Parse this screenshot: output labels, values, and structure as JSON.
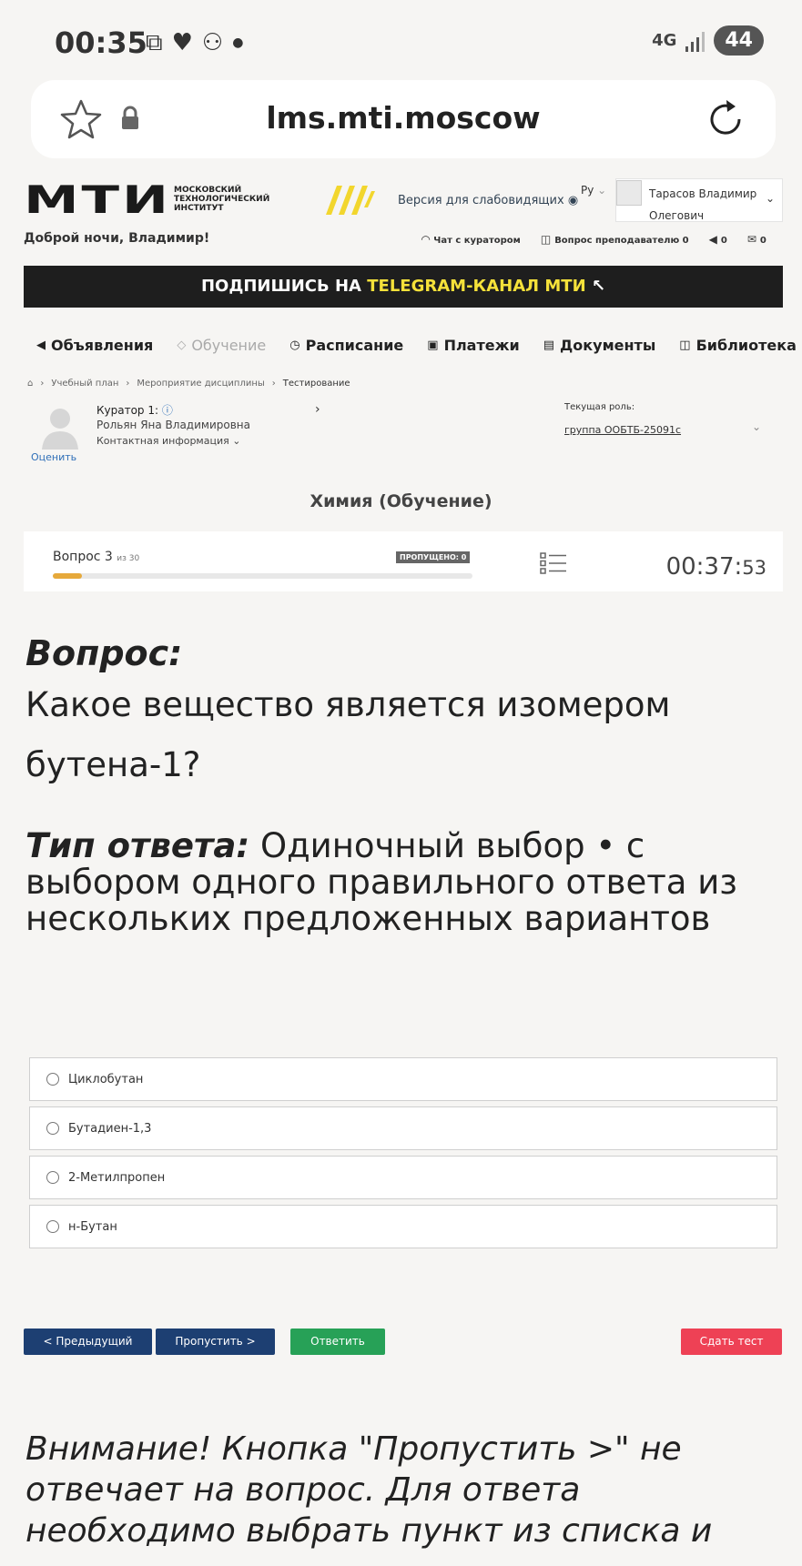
{
  "status_bar": {
    "time": "00:35",
    "network": "4G",
    "battery": "44"
  },
  "browser": {
    "url": "lms.mti.moscow"
  },
  "site": {
    "logo_text": "МТИ",
    "logo_subtitle": "МОСКОВСКИЙ ТЕХНОЛОГИЧЕСКИЙ ИНСТИТУТ",
    "low_vision_link": "Версия для слабовидящих",
    "language": "Ру",
    "user_name": "Тарасов Владимир Олегович",
    "greeting": "Доброй ночи, Владимир!",
    "top_links": [
      {
        "label": "Чат с куратором"
      },
      {
        "label": "Вопрос преподавателю 0"
      },
      {
        "label": "0"
      },
      {
        "label": "0"
      }
    ],
    "banner_prefix": "ПОДПИШИСЬ НА ",
    "banner_highlight": "TELEGRAM-КАНАЛ МТИ",
    "nav": [
      {
        "label": "Объявления"
      },
      {
        "label": "Обучение"
      },
      {
        "label": "Расписание"
      },
      {
        "label": "Платежи"
      },
      {
        "label": "Документы"
      },
      {
        "label": "Библиотека"
      }
    ],
    "breadcrumbs": [
      "Учебный план",
      "Мероприятие дисциплины",
      "Тестирование"
    ]
  },
  "curator": {
    "title": "Куратор 1:",
    "name": "Рольян Яна Владимировна",
    "contact": "Контактная информация",
    "rate": "Оценить",
    "role_label": "Текущая роль:",
    "role_value": "группа ООБТБ-25091с"
  },
  "course_title": "Химия (Обучение)",
  "question_bar": {
    "label": "Вопрос 3",
    "of": "из 30",
    "skipped": "ПРОПУЩЕНО: 0",
    "progress": 0.07,
    "timer_main": "00:37:",
    "timer_sec": "53"
  },
  "question": {
    "heading": "Вопрос:",
    "text": "Какое вещество является изомером бутена-1?",
    "type_label": "Тип ответа:",
    "type_text": "Одиночный выбор • с выбором одного правильного ответа из нескольких предложенных вариантов"
  },
  "options": [
    {
      "label": "Циклобутан"
    },
    {
      "label": "Бутадиен-1,3"
    },
    {
      "label": "2-Метилпропен"
    },
    {
      "label": "н-Бутан"
    }
  ],
  "buttons": {
    "prev": "< Предыдущий",
    "skip": "Пропустить >",
    "answer": "Ответить",
    "submit": "Сдать тест"
  },
  "warning": "Внимание! Кнопка \"Пропустить >\" не отвечает на вопрос. Для ответа необходимо выбрать пункт из списка и",
  "colors": {
    "nav_dark": "#1d3f72",
    "answer_green": "#27a157",
    "submit_red": "#ee4155",
    "banner_yellow": "#f5e13a",
    "progress": "#e6a93b"
  }
}
